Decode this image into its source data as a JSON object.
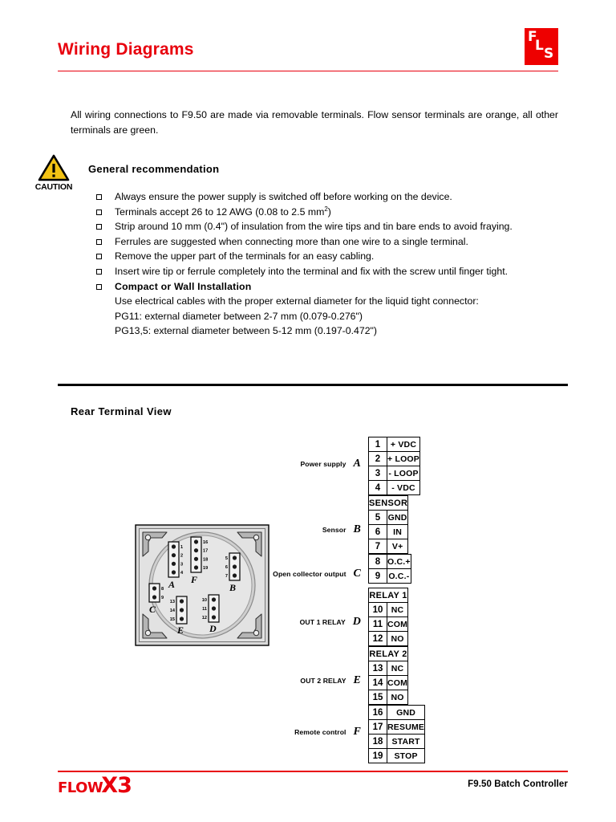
{
  "header": {
    "title": "Wiring Diagrams",
    "logo": {
      "f": "F",
      "l": "L",
      "s": "S"
    },
    "accent_color": "#e8000d"
  },
  "intro": {
    "paragraph": "All wiring connections to F9.50 are made via removable terminals. Flow sensor terminals are orange, all other terminals are green."
  },
  "caution": {
    "label": "CAUTION",
    "heading": "General recommendation",
    "triangle_color": "#f2c214"
  },
  "recommendations": [
    {
      "text": "Always ensure the power supply is switched off before working on the device."
    },
    {
      "text": "Terminals accept 26 to 12 AWG (0.08 to 2.5 mm",
      "sup": "2",
      "text_after": ")"
    },
    {
      "text": "Strip around 10 mm (0.4\") of insulation from the wire tips and tin bare ends to avoid fraying."
    },
    {
      "text": "Ferrules are suggested when connecting more than one wire to a single terminal."
    },
    {
      "text": "Remove the upper part of the terminals for an easy cabling."
    },
    {
      "text": "Insert wire tip or ferrule completely into the terminal and fix with the screw until finger tight."
    }
  ],
  "install": {
    "heading": "Compact or Wall Installation",
    "body": "Use electrical cables with the proper external diameter for the liquid tight connector:",
    "pg11": "PG11: external diameter between 2-7 mm (0.079-0.276\")",
    "pg135": "PG13,5: external diameter between 5-12 mm (0.197-0.472\")"
  },
  "rear_view": {
    "title": "Rear Terminal View",
    "blocks": [
      {
        "letter": "A",
        "pins": [
          "1",
          "2",
          "3",
          "4"
        ],
        "labels_side": "right"
      },
      {
        "letter": "F",
        "pins": [
          "16",
          "17",
          "18",
          "19"
        ],
        "labels_side": "right"
      },
      {
        "letter": "B",
        "pins": [
          "5",
          "6",
          "7"
        ],
        "labels_side": "left"
      },
      {
        "letter": "C",
        "pins": [
          "8",
          "9"
        ],
        "labels_side": "right"
      },
      {
        "letter": "E",
        "pins": [
          "13",
          "14",
          "15"
        ],
        "labels_side": "left"
      },
      {
        "letter": "D",
        "pins": [
          "10",
          "11",
          "12"
        ],
        "labels_side": "left"
      }
    ]
  },
  "terminals": [
    {
      "caption": "Power supply",
      "letter": "A",
      "header": null,
      "rows": [
        {
          "num": "1",
          "label": "+ VDC"
        },
        {
          "num": "2",
          "label": "+ LOOP"
        },
        {
          "num": "3",
          "label": "- LOOP"
        },
        {
          "num": "4",
          "label": "- VDC"
        }
      ]
    },
    {
      "caption": "Sensor",
      "letter": "B",
      "header": "SENSOR",
      "rows": [
        {
          "num": "5",
          "label": "GND"
        },
        {
          "num": "6",
          "label": "IN"
        },
        {
          "num": "7",
          "label": "V+"
        }
      ]
    },
    {
      "caption": "Open collector output",
      "letter": "C",
      "header": null,
      "rows": [
        {
          "num": "8",
          "label": "O.C.+"
        },
        {
          "num": "9",
          "label": "O.C.-"
        }
      ]
    },
    {
      "caption": "OUT 1 RELAY",
      "letter": "D",
      "header": "RELAY 1",
      "rows": [
        {
          "num": "10",
          "label": "NC"
        },
        {
          "num": "11",
          "label": "COM"
        },
        {
          "num": "12",
          "label": "NO"
        }
      ]
    },
    {
      "caption": "OUT 2 RELAY",
      "letter": "E",
      "header": "RELAY 2",
      "rows": [
        {
          "num": "13",
          "label": "NC"
        },
        {
          "num": "14",
          "label": "COM"
        },
        {
          "num": "15",
          "label": "NO"
        }
      ]
    },
    {
      "caption": "Remote control",
      "letter": "F",
      "header": null,
      "rows": [
        {
          "num": "16",
          "label": "GND"
        },
        {
          "num": "17",
          "label": "RESUME"
        },
        {
          "num": "18",
          "label": "START"
        },
        {
          "num": "19",
          "label": "STOP"
        }
      ]
    }
  ],
  "footer": {
    "logo_flow": "FLOW",
    "logo_x3": "X3",
    "right_text": "F9.50 Batch Controller"
  }
}
